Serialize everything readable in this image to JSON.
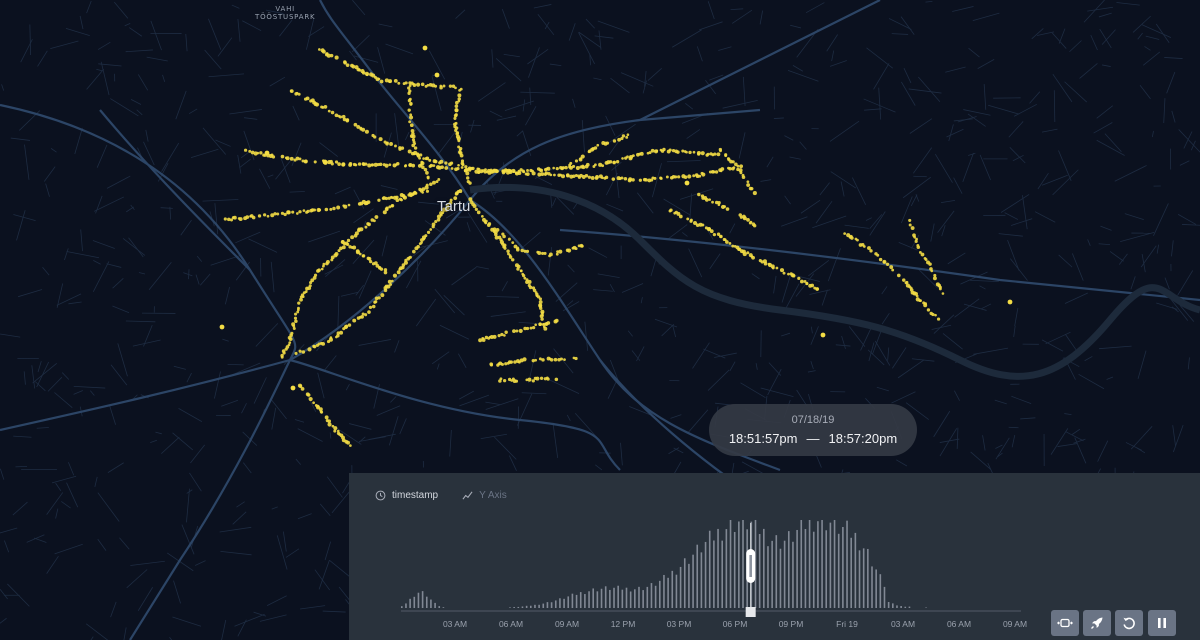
{
  "map": {
    "place_label_line1": "VAHI",
    "place_label_line2": "TÖÖSTUSPARK",
    "city_label": "Tartu",
    "colors": {
      "background": "#0b111f",
      "roads": "#1e2c42",
      "main_roads": "#2c4566",
      "river": "#1d2a3b",
      "points": "#f3dd45"
    }
  },
  "time_tooltip": {
    "date": "07/18/19",
    "start_time": "18:51:57pm",
    "separator": "—",
    "end_time": "18:57:20pm"
  },
  "timeline": {
    "tabs": [
      {
        "label": "timestamp",
        "icon": "clock-icon",
        "active": true
      },
      {
        "label": "Y Axis",
        "icon": "line-chart-icon",
        "active": false
      }
    ],
    "x_ticks": [
      "03 AM",
      "06 AM",
      "09 AM",
      "12 PM",
      "03 PM",
      "06 PM",
      "09 PM",
      "Fri 19",
      "03 AM",
      "06 AM",
      "09 AM"
    ],
    "playhead_fraction": 0.564,
    "histogram_color": "#818894",
    "controls": [
      {
        "name": "animation-window-button",
        "icon": "window-range-icon"
      },
      {
        "name": "speed-button",
        "icon": "rocket-icon"
      },
      {
        "name": "reset-button",
        "icon": "reset-icon"
      },
      {
        "name": "pause-button",
        "icon": "pause-icon"
      }
    ]
  }
}
